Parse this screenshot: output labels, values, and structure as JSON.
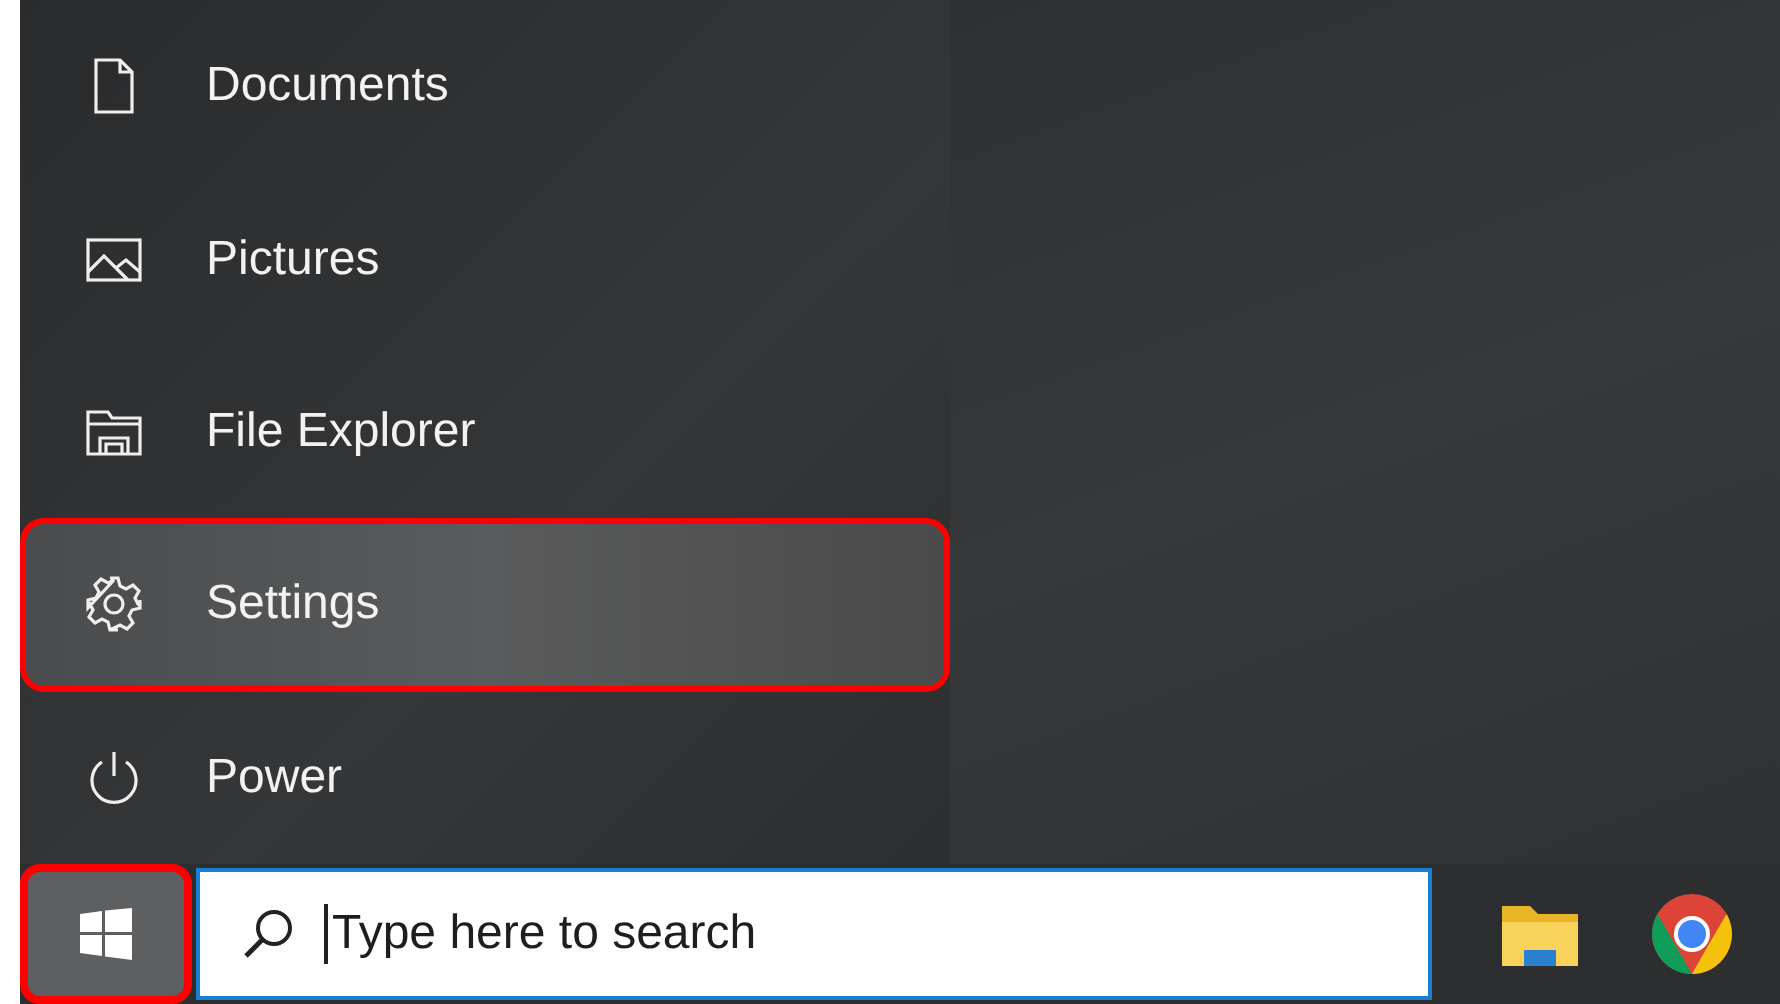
{
  "start_menu": {
    "items": [
      {
        "kind": "document",
        "label": "Documents",
        "selected": false,
        "annotated": false
      },
      {
        "kind": "picture",
        "label": "Pictures",
        "selected": false,
        "annotated": false
      },
      {
        "kind": "explorer",
        "label": "File Explorer",
        "selected": false,
        "annotated": false
      },
      {
        "kind": "settings",
        "label": "Settings",
        "selected": true,
        "annotated": true
      },
      {
        "kind": "power",
        "label": "Power",
        "selected": false,
        "annotated": false
      }
    ]
  },
  "taskbar": {
    "start_button": {
      "annotated": true
    },
    "search": {
      "placeholder": "Type here to search"
    }
  }
}
